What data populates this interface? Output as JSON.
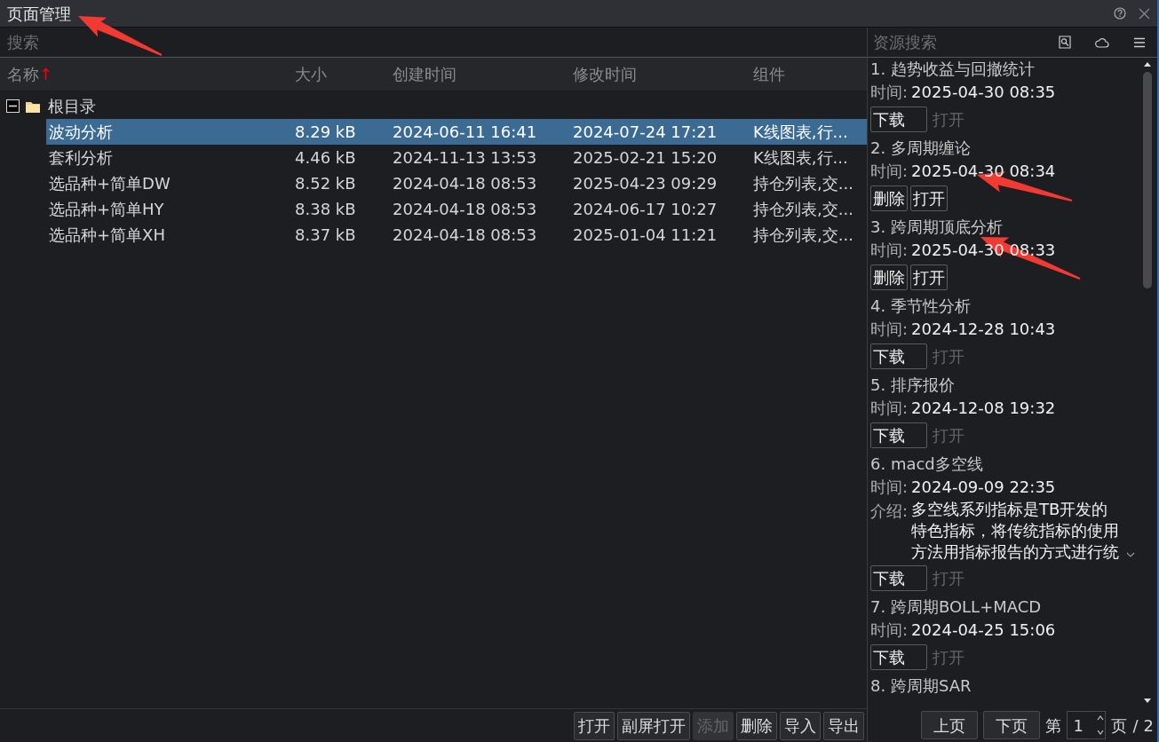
{
  "window": {
    "title": "页面管理"
  },
  "search": {
    "placeholder": "搜索"
  },
  "table": {
    "columns": [
      {
        "label": "名称",
        "sort_indicator": "↑"
      },
      {
        "label": "大小"
      },
      {
        "label": "创建时间"
      },
      {
        "label": "修改时间"
      },
      {
        "label": "组件"
      }
    ],
    "tree": [
      {
        "name": "根目录",
        "expanded": true,
        "children": [
          {
            "name": "波动分析",
            "size": "8.29 kB",
            "created": "2024-06-11 16:41",
            "modified": "2024-07-24 17:21",
            "components": "K线图表,行...",
            "selected": true
          },
          {
            "name": "套利分析",
            "size": "4.46 kB",
            "created": "2024-11-13 13:53",
            "modified": "2025-02-21 15:20",
            "components": "K线图表,行...",
            "selected": false
          },
          {
            "name": "选品种+简单DW",
            "size": "8.52 kB",
            "created": "2024-04-18 08:53",
            "modified": "2025-04-23 09:29",
            "components": "持仓列表,交...",
            "selected": false
          },
          {
            "name": "选品种+简单HY",
            "size": "8.38 kB",
            "created": "2024-04-18 08:53",
            "modified": "2024-06-17 10:27",
            "components": "持仓列表,交...",
            "selected": false
          },
          {
            "name": "选品种+简单XH",
            "size": "8.37 kB",
            "created": "2024-04-18 08:53",
            "modified": "2025-01-04 11:21",
            "components": "持仓列表,交...",
            "selected": false
          }
        ]
      }
    ]
  },
  "toolbar": [
    {
      "label": "打开",
      "disabled": false
    },
    {
      "label": "副屏打开",
      "disabled": false
    },
    {
      "label": "添加",
      "disabled": true
    },
    {
      "label": "删除",
      "disabled": false
    },
    {
      "label": "导入",
      "disabled": false
    },
    {
      "label": "导出",
      "disabled": false
    }
  ],
  "resources": {
    "search": {
      "placeholder": "资源搜索"
    },
    "items": [
      {
        "index": "1.",
        "title": "趋势收益与回撤统计",
        "time_label": "时间:",
        "time": "2025-04-30 08:35",
        "buttons": [
          {
            "label": "下载",
            "disabled": false
          },
          {
            "label": "打开",
            "disabled": true
          }
        ]
      },
      {
        "index": "2.",
        "title": "多周期缠论",
        "time_label": "时间:",
        "time": "2025-04-30 08:34",
        "buttons": [
          {
            "label": "删除",
            "disabled": false
          },
          {
            "label": "打开",
            "disabled": false
          }
        ]
      },
      {
        "index": "3.",
        "title": "跨周期顶底分析",
        "time_label": "时间:",
        "time": "2025-04-30 08:33",
        "buttons": [
          {
            "label": "删除",
            "disabled": false
          },
          {
            "label": "打开",
            "disabled": false
          }
        ]
      },
      {
        "index": "4.",
        "title": "季节性分析",
        "time_label": "时间:",
        "time": "2024-12-28 10:43",
        "buttons": [
          {
            "label": "下载",
            "disabled": false
          },
          {
            "label": "打开",
            "disabled": true
          }
        ]
      },
      {
        "index": "5.",
        "title": "排序报价",
        "time_label": "时间:",
        "time": "2024-12-08 19:32",
        "buttons": [
          {
            "label": "下载",
            "disabled": false
          },
          {
            "label": "打开",
            "disabled": true
          }
        ]
      },
      {
        "index": "6.",
        "title": "macd多空线",
        "time_label": "时间:",
        "time": "2024-09-09 22:35",
        "intro_label": "介绍:",
        "intro": "多空线系列指标是TB开发的特色指标，将传统指标的使用方法用指标报告的方式进行统",
        "buttons": [
          {
            "label": "下载",
            "disabled": false
          },
          {
            "label": "打开",
            "disabled": true
          }
        ]
      },
      {
        "index": "7.",
        "title": "跨周期BOLL+MACD",
        "time_label": "时间:",
        "time": "2024-04-25 15:06",
        "buttons": [
          {
            "label": "下载",
            "disabled": false
          },
          {
            "label": "打开",
            "disabled": true
          }
        ]
      },
      {
        "index": "8.",
        "title": "跨周期SAR"
      }
    ],
    "pager": {
      "prev": "上页",
      "next": "下页",
      "page_prefix": "第",
      "page": "1",
      "page_suffix": "页",
      "separator": "/",
      "total": "2"
    }
  },
  "annotations": [
    {
      "kind": "arrow"
    },
    {
      "kind": "arrow"
    },
    {
      "kind": "arrow"
    }
  ]
}
